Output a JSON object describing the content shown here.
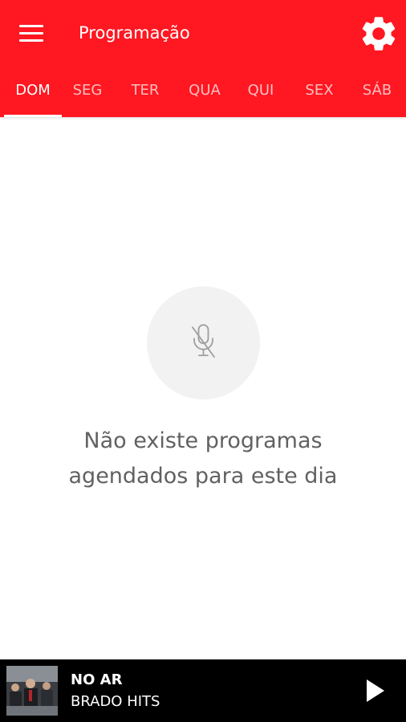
{
  "header": {
    "title": "Programação",
    "background_color": "#ff1721"
  },
  "tabs": [
    {
      "label": "DOM",
      "active": true
    },
    {
      "label": "SEG",
      "active": false
    },
    {
      "label": "TER",
      "active": false
    },
    {
      "label": "QUA",
      "active": false
    },
    {
      "label": "QUI",
      "active": false
    },
    {
      "label": "SEX",
      "active": false
    },
    {
      "label": "SÁB",
      "active": false
    }
  ],
  "empty_state": {
    "icon": "mic-off-icon",
    "line1": "Não existe programas",
    "line2": "agendados para este dia"
  },
  "player": {
    "status_label": "NO AR",
    "station_name": "BRADO HITS",
    "play_icon": "play-icon"
  }
}
